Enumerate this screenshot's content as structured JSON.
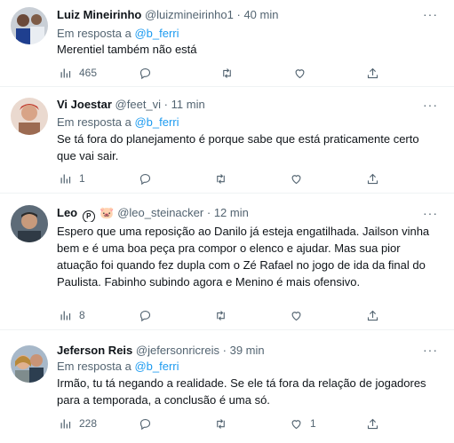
{
  "tweets": [
    {
      "name": "Luiz Mineirinho",
      "handle": "@luizmineirinho1",
      "sep": "·",
      "time": "40 min",
      "reply_prefix": "Em resposta a",
      "reply_to": "@b_ferri",
      "text": "Merentiel também não está",
      "views": "465",
      "replies": "",
      "retweets": "",
      "likes": ""
    },
    {
      "name": "Vi Joestar",
      "handle": "@feet_vi",
      "sep": "·",
      "time": "11 min",
      "reply_prefix": "Em resposta a",
      "reply_to": "@b_ferri",
      "text": "Se tá fora do planejamento é porque sabe que está praticamente certo que vai sair.",
      "views": "1",
      "replies": "",
      "retweets": "",
      "likes": ""
    },
    {
      "name": "Leo",
      "name_emoji": "🐷",
      "badge_letter": "P",
      "handle": "@leo_steinacker",
      "sep": "·",
      "time": "12 min",
      "text": "Espero que uma reposição ao Danilo já esteja engatilhada. Jailson vinha bem e é uma boa peça pra compor o elenco e ajudar. Mas sua pior atuação foi quando fez dupla com o Zé Rafael no jogo de ida da final do Paulista. Fabinho subindo agora e Menino é mais ofensivo.",
      "views": "8",
      "replies": "",
      "retweets": "",
      "likes": ""
    },
    {
      "name": "Jeferson Reis",
      "handle": "@jefersonricreis",
      "sep": "·",
      "time": "39 min",
      "reply_prefix": "Em resposta a",
      "reply_to": "@b_ferri",
      "text": "Irmão, tu tá negando a realidade. Se ele tá fora da relação de jogadores para a temporada, a conclusão é uma só.",
      "views": "228",
      "replies": "",
      "retweets": "",
      "likes": "1"
    }
  ],
  "more_label": "···",
  "colors": {
    "accent": "#1d9bf0",
    "secondary_text": "#536471",
    "divider": "#eff3f4"
  },
  "icons": [
    "more-icon",
    "views-icon",
    "reply-icon",
    "retweet-icon",
    "like-icon",
    "share-icon"
  ]
}
